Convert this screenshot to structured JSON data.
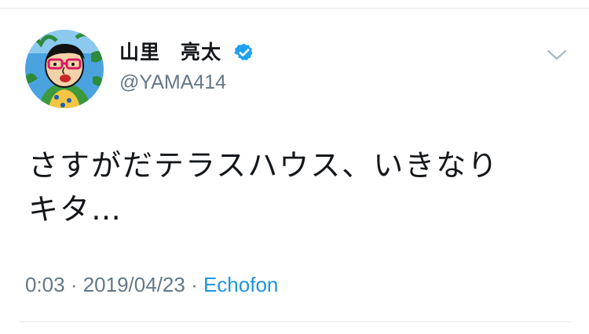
{
  "tweet": {
    "author": {
      "display_name": "山里　亮太",
      "handle": "@YAMA414",
      "verified": true,
      "avatar_icon": "cartoon-portrait-avatar"
    },
    "text_line1": "さすがだテラスハウス、いきなり",
    "text_line2": "キタ…",
    "time": "0:03",
    "separator": " · ",
    "date": "2019/04/23",
    "source": "Echofon"
  },
  "icons": {
    "verified": "verified-badge-icon",
    "menu": "chevron-down-icon"
  },
  "colors": {
    "text": "#14171a",
    "secondary_text": "#657786",
    "link": "#1b95e0",
    "verified_badge": "#1da1f2",
    "divider": "#e1e8ed"
  }
}
